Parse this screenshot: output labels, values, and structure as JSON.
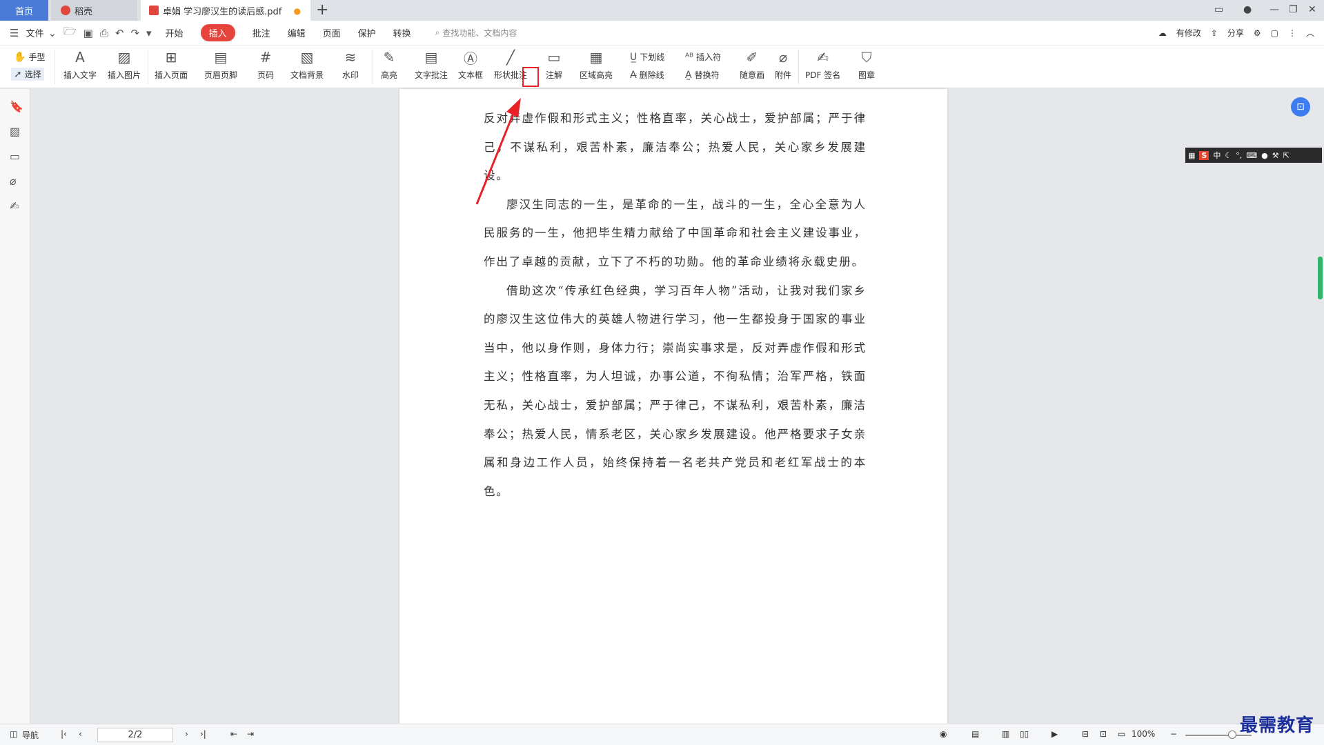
{
  "titlebar": {
    "tabs": [
      {
        "label": "首页"
      },
      {
        "label": "稻壳"
      },
      {
        "label": "卓娟 学习廖汉生的读后感.pdf"
      }
    ],
    "modified_mark": "●",
    "new_tab": "+"
  },
  "menubar": {
    "file": "文件",
    "tabs": [
      "开始",
      "插入",
      "批注",
      "编辑",
      "页面",
      "保护",
      "转换"
    ],
    "active_tab": "插入",
    "search_placeholder": "查找功能、文档内容",
    "right": {
      "modify": "有修改",
      "share": "分享"
    }
  },
  "ribbon": {
    "hand": "手型",
    "select": "选择",
    "insert_text": "插入文字",
    "insert_image": "插入图片",
    "insert_page": "插入页面",
    "header_footer": "页眉页脚",
    "page_number": "页码",
    "doc_background": "文档背景",
    "watermark": "水印",
    "highlight": "高亮",
    "text_comment": "文字批注",
    "text_box": "文本框",
    "shape_comment": "形状批注",
    "note": "注解",
    "area_highlight": "区域高亮",
    "underline": "下划线",
    "strikethrough": "删除线",
    "insert_symbol": "插入符",
    "replace_symbol": "替换符",
    "freehand": "随意画",
    "attachment": "附件",
    "pdf_sign": "PDF 签名",
    "stamp": "图章"
  },
  "document": {
    "paragraphs": [
      {
        "indent": false,
        "text": "反对弄虚作假和形式主义；性格直率，关心战士，爱护部属；严于律己，不谋私利，艰苦朴素，廉洁奉公；热爱人民，关心家乡发展建设。"
      },
      {
        "indent": true,
        "text": "廖汉生同志的一生，是革命的一生，战斗的一生，全心全意为人民服务的一生，他把毕生精力献给了中国革命和社会主义建设事业，作出了卓越的贡献，立下了不朽的功勋。他的革命业绩将永载史册。"
      },
      {
        "indent": true,
        "text": "借助这次“传承红色经典，学习百年人物”活动，让我对我们家乡的廖汉生这位伟大的英雄人物进行学习，他一生都投身于国家的事业当中，他以身作则，身体力行；崇尚实事求是，反对弄虚作假和形式主义；性格直率，为人坦诚，办事公道，不徇私情；治军严格，铁面无私，关心战士，爱护部属；严于律己，不谋私利，艰苦朴素，廉洁奉公；热爱人民，情系老区，关心家乡发展建设。他严格要求子女亲属和身边工作人员，始终保持着一名老共产党员和老红军战士的本色。"
      }
    ]
  },
  "ime": {
    "s": "S",
    "lang": "中"
  },
  "statusbar": {
    "nav": "导航",
    "page": "2/2",
    "zoom": "100%"
  },
  "watermark_text": "最需教育",
  "colors": {
    "accent": "#e5453d",
    "annotation": "#e82127",
    "home_tab": "#4a7bd8"
  }
}
